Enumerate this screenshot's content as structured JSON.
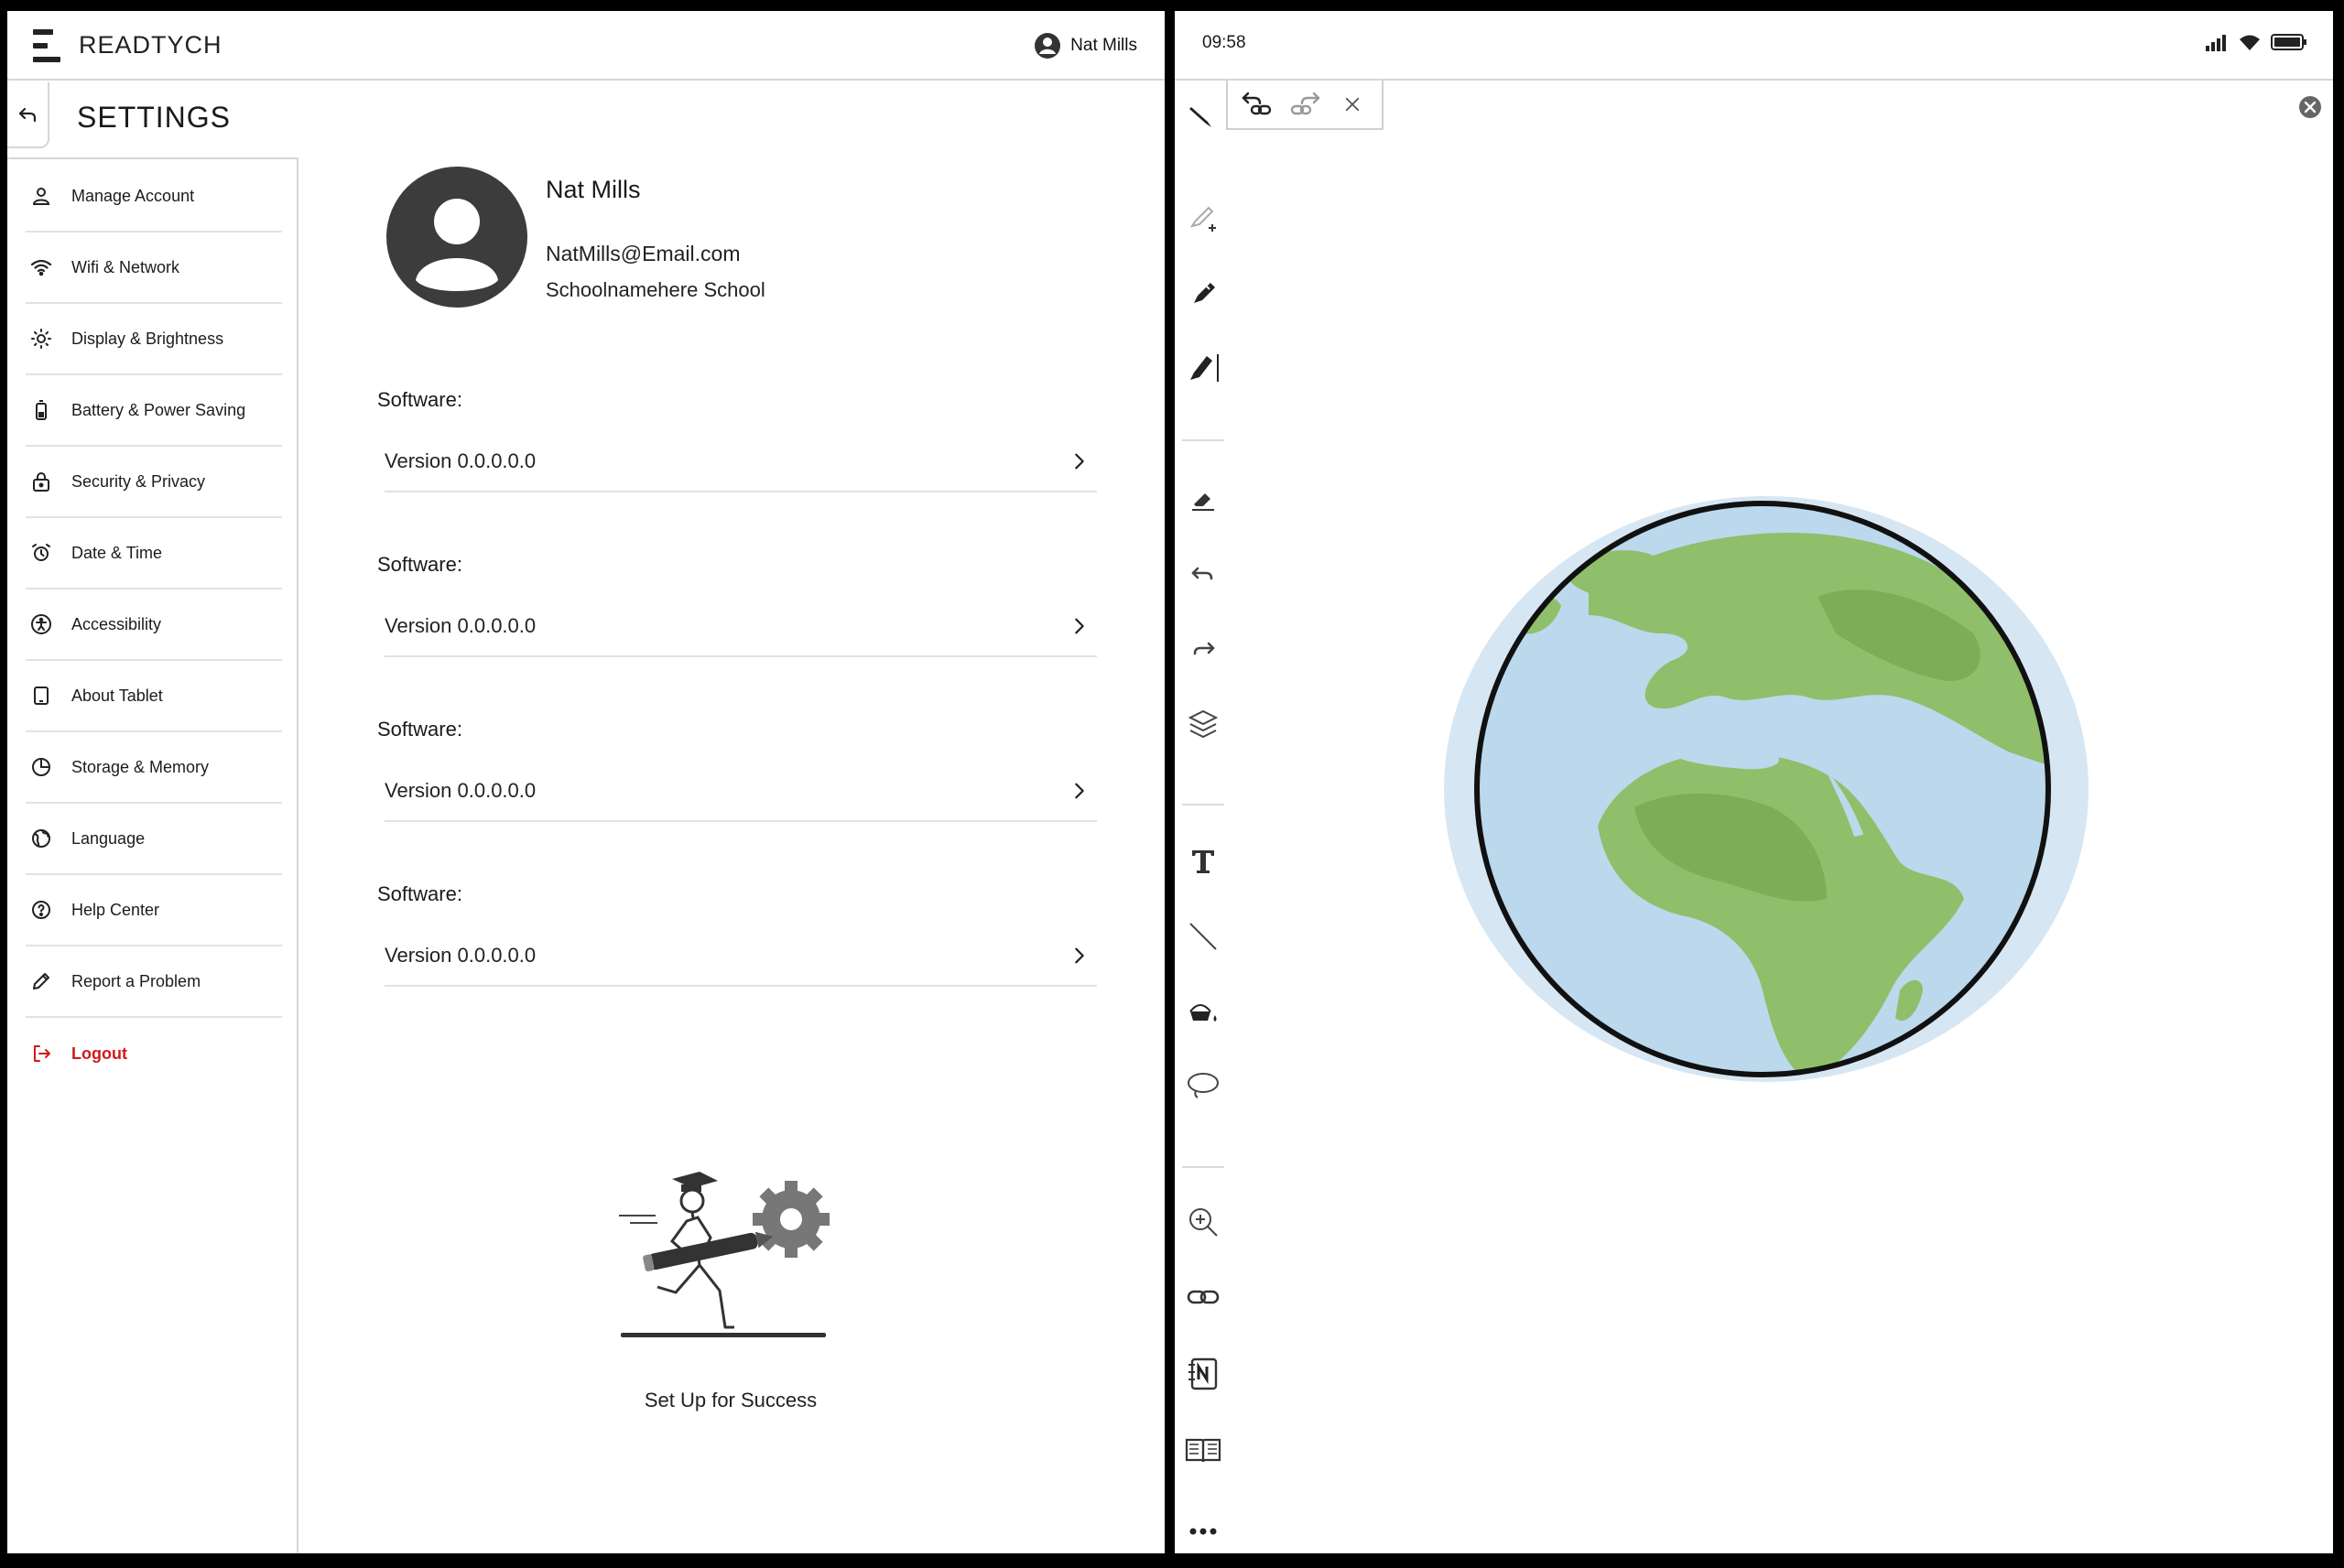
{
  "app": {
    "logo_text": "READTYCH"
  },
  "header": {
    "user_name": "Nat Mills"
  },
  "settings": {
    "title": "SETTINGS"
  },
  "sidebar": {
    "items": [
      {
        "label": "Manage Account",
        "icon": "user-icon"
      },
      {
        "label": "Wifi & Network",
        "icon": "wifi-icon"
      },
      {
        "label": "Display & Brightness",
        "icon": "brightness-icon"
      },
      {
        "label": "Battery & Power Saving",
        "icon": "battery-icon"
      },
      {
        "label": "Security & Privacy",
        "icon": "lock-icon"
      },
      {
        "label": "Date & Time",
        "icon": "alarm-clock-icon"
      },
      {
        "label": "Accessibility",
        "icon": "accessibility-icon"
      },
      {
        "label": "About Tablet",
        "icon": "tablet-icon"
      },
      {
        "label": "Storage & Memory",
        "icon": "pie-chart-icon"
      },
      {
        "label": "Language",
        "icon": "globe-icon"
      },
      {
        "label": "Help Center",
        "icon": "help-icon"
      },
      {
        "label": "Report a Problem",
        "icon": "pencil-icon"
      },
      {
        "label": "Logout",
        "icon": "logout-icon"
      }
    ]
  },
  "profile": {
    "name": "Nat Mills",
    "email": "NatMills@Email.com",
    "school": "Schoolnamehere School"
  },
  "software": [
    {
      "label": "Software:",
      "version": "Version 0.0.0.0.0"
    },
    {
      "label": "Software:",
      "version": "Version 0.0.0.0.0"
    },
    {
      "label": "Software:",
      "version": "Version 0.0.0.0.0"
    },
    {
      "label": "Software:",
      "version": "Version 0.0.0.0.0"
    }
  ],
  "hero": {
    "caption": "Set Up for Success"
  },
  "tablet": {
    "time": "09:58",
    "colors": {
      "logout_red": "#d11a1a",
      "globe_ocean": "#bcd8ec",
      "globe_land": "#8fbf6a"
    }
  }
}
